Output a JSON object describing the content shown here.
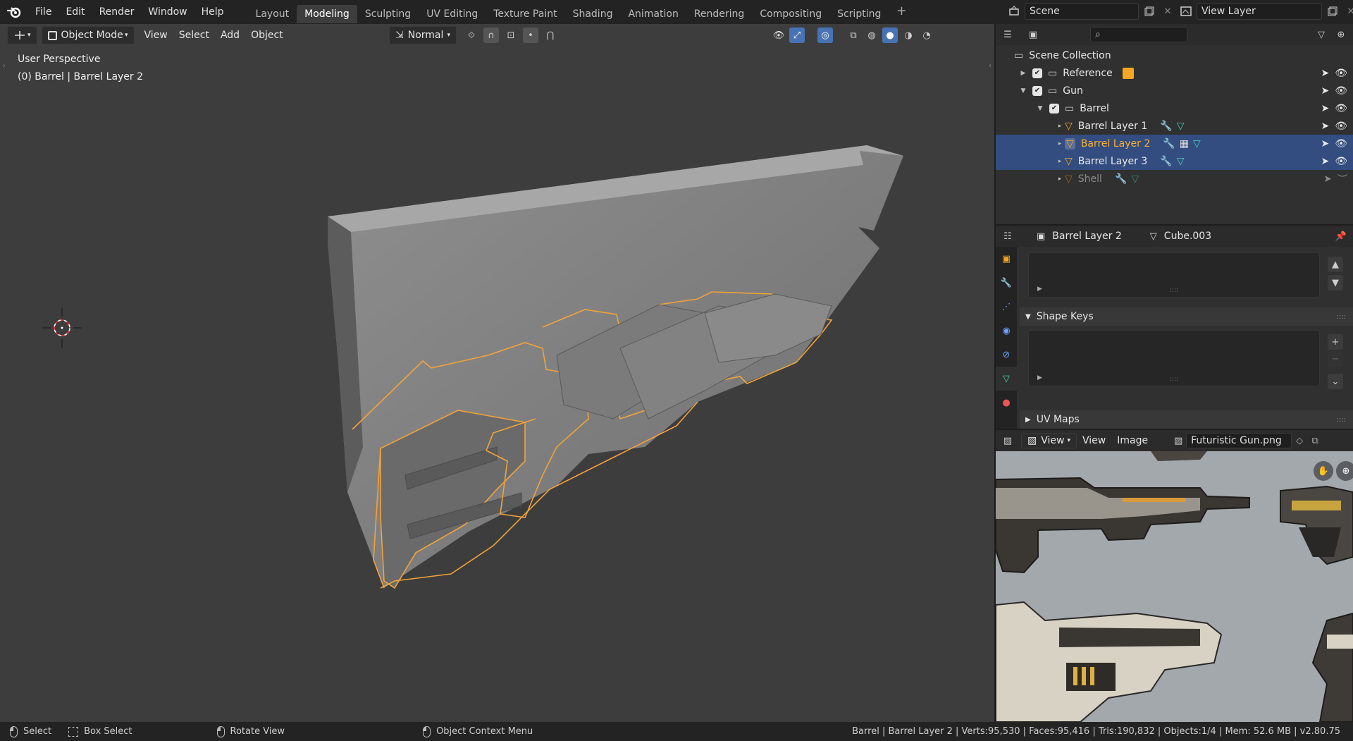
{
  "menu": [
    "File",
    "Edit",
    "Render",
    "Window",
    "Help"
  ],
  "workspaces": [
    "Layout",
    "Modeling",
    "Sculpting",
    "UV Editing",
    "Texture Paint",
    "Shading",
    "Animation",
    "Rendering",
    "Compositing",
    "Scripting"
  ],
  "active_workspace": "Modeling",
  "scene": {
    "name": "Scene",
    "view_layer": "View Layer"
  },
  "viewport": {
    "mode": "Object Mode",
    "menu": [
      "View",
      "Select",
      "Add",
      "Object"
    ],
    "orientation": "Normal",
    "overlay_line1": "User Perspective",
    "overlay_line2": "(0) Barrel | Barrel Layer 2"
  },
  "outliner": {
    "search_placeholder": "",
    "root": "Scene Collection",
    "rows": [
      {
        "label": "Reference",
        "depth": 1
      },
      {
        "label": "Gun",
        "depth": 1
      },
      {
        "label": "Barrel",
        "depth": 2
      },
      {
        "label": "Barrel Layer 1",
        "depth": 3
      },
      {
        "label": "Barrel Layer 2",
        "depth": 3,
        "active": true
      },
      {
        "label": "Barrel Layer 3",
        "depth": 3
      },
      {
        "label": "Shell",
        "depth": 3,
        "dim": true
      }
    ]
  },
  "properties": {
    "object": "Barrel Layer 2",
    "mesh": "Cube.003",
    "shape_keys": "Shape Keys",
    "uv_maps": "UV Maps"
  },
  "image_editor": {
    "menu": [
      "View",
      "View",
      "Image"
    ],
    "image": "Futuristic Gun.png"
  },
  "status": {
    "select": "Select",
    "box_select": "Box Select",
    "rotate": "Rotate View",
    "context": "Object Context Menu",
    "stats": "Barrel | Barrel Layer 2 | Verts:95,530 | Faces:95,416 | Tris:190,832 | Objects:1/4 | Mem: 52.6 MB | v2.80.75"
  },
  "colors": {
    "accent": "#f5a623",
    "selection": "#334d80",
    "active_text": "#ffaf29"
  }
}
